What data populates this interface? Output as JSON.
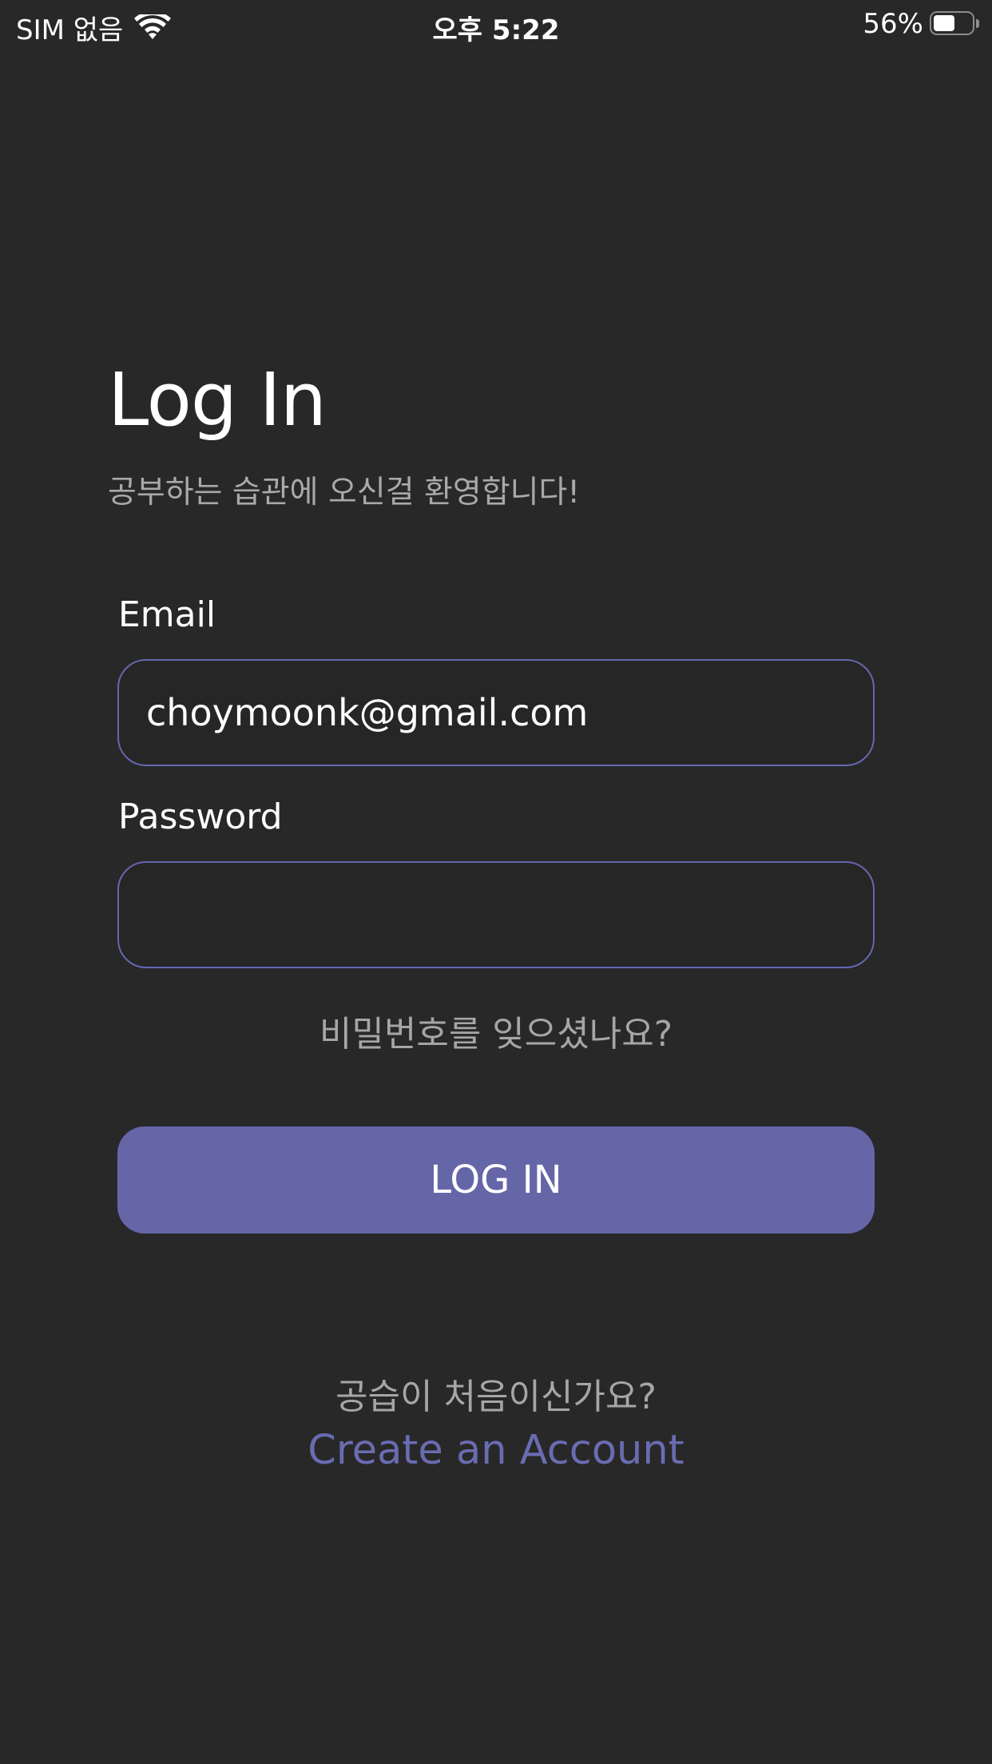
{
  "status_bar": {
    "carrier": "SIM 없음",
    "time": "오후 5:22",
    "battery_percent_text": "56%",
    "battery_level": 0.56
  },
  "header": {
    "title": "Log In",
    "subtitle": "공부하는 습관에 오신걸 환영합니다!"
  },
  "form": {
    "email_label": "Email",
    "email_value": "choymoonk@gmail.com",
    "password_label": "Password",
    "password_value": "",
    "forgot_password": "비밀번호를 잊으셨나요?",
    "login_button": "LOG IN"
  },
  "footer": {
    "prompt": "공습이 처음이신가요?",
    "create_account": "Create an Account"
  },
  "colors": {
    "background": "#282828",
    "accent": "#6566a8",
    "input_border": "#6567b0",
    "muted_text": "#a6a6a6"
  }
}
